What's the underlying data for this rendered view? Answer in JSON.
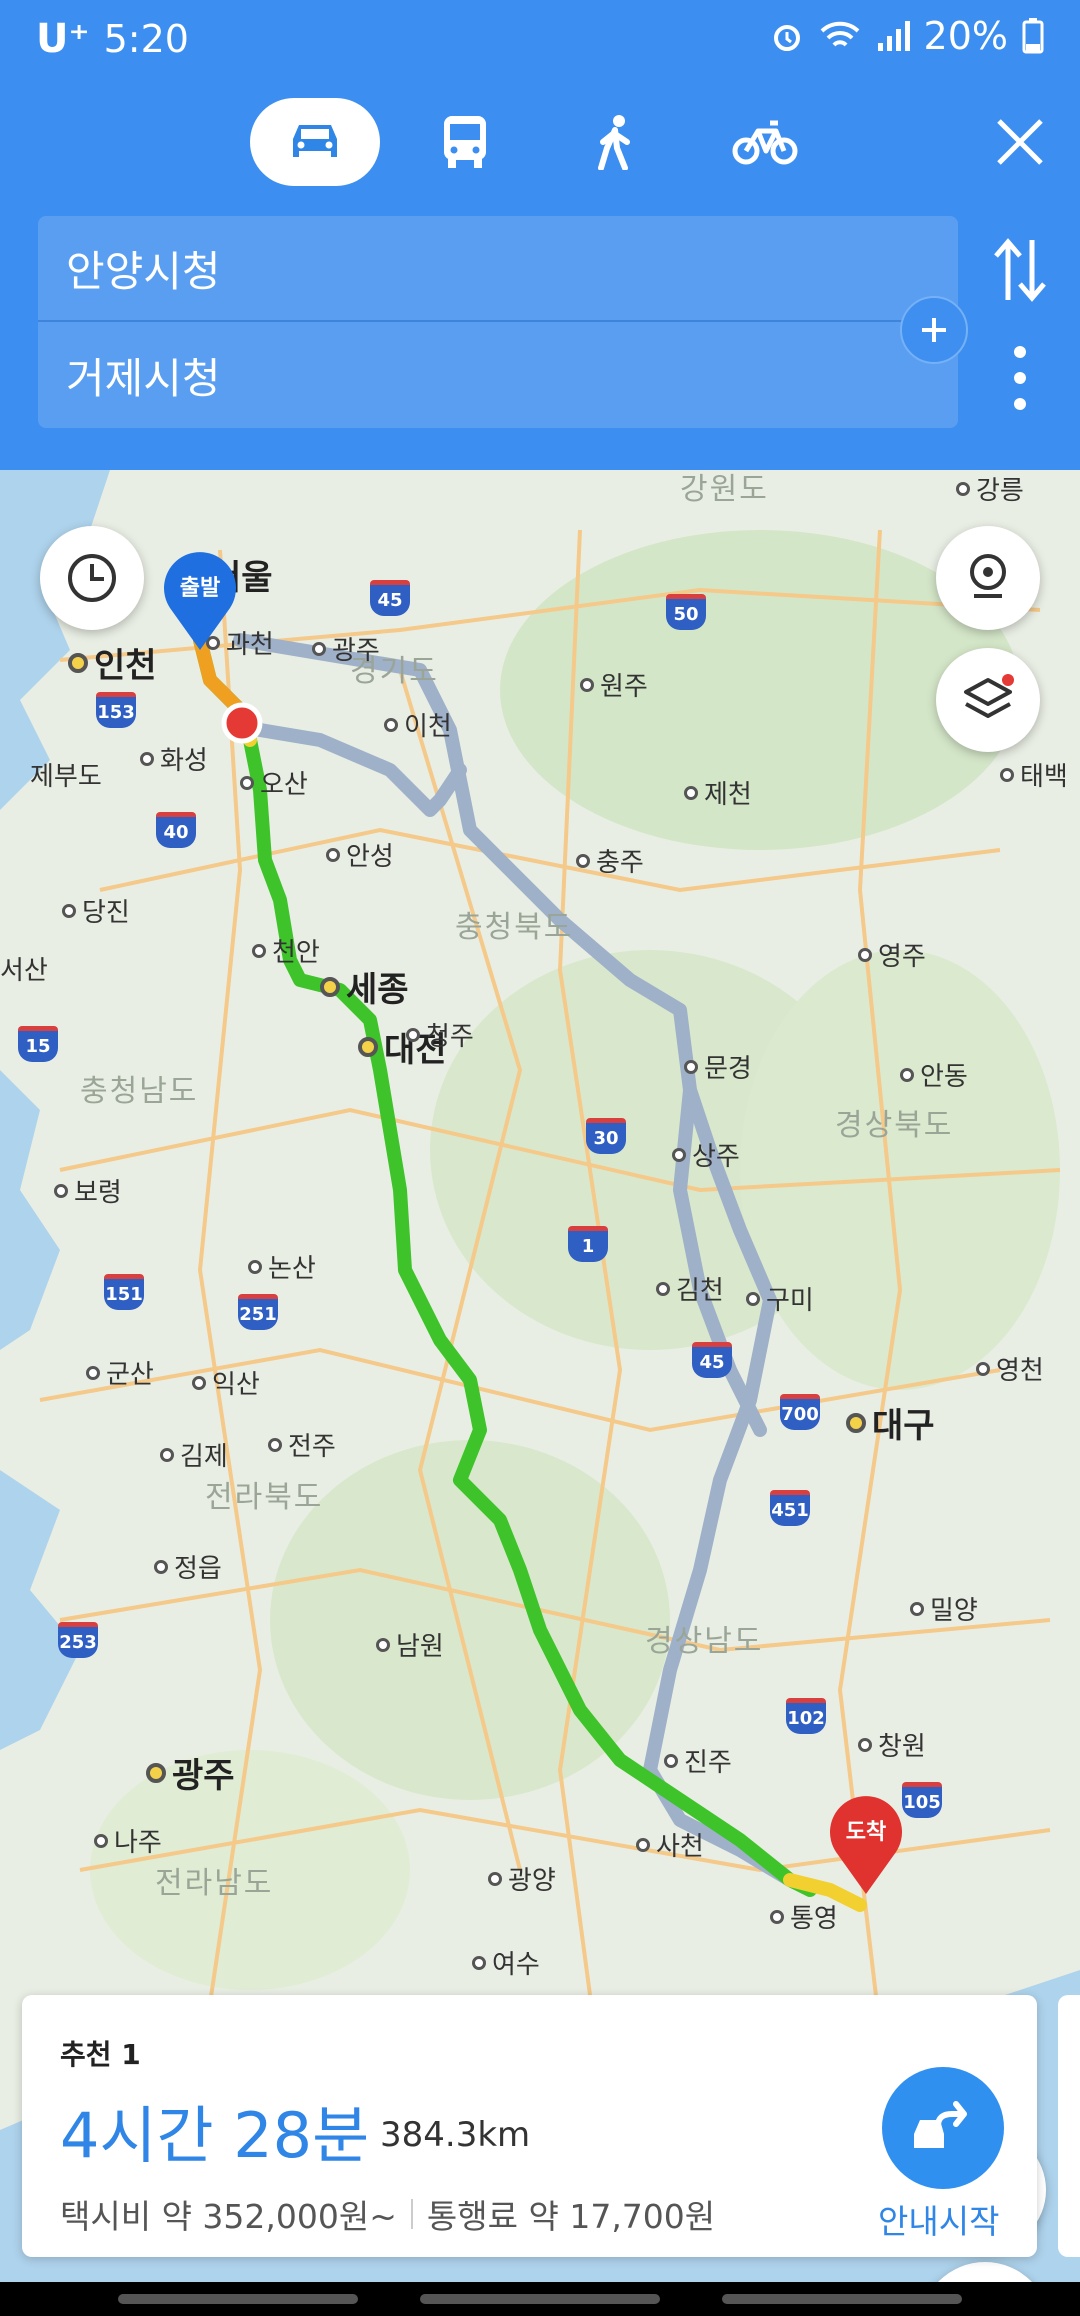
{
  "status_bar": {
    "carrier": "U⁺",
    "time": "5:20",
    "battery": "20%",
    "icons": [
      "alarm-icon",
      "wifi-icon",
      "signal-icon",
      "battery-icon"
    ]
  },
  "modes": [
    {
      "name": "car-icon",
      "active": true
    },
    {
      "name": "bus-icon",
      "active": false
    },
    {
      "name": "walk-icon",
      "active": false
    },
    {
      "name": "bike-icon",
      "active": false
    }
  ],
  "route": {
    "origin": "안양시청",
    "destination": "거제시청"
  },
  "map": {
    "regions": [
      "강원도",
      "경기도",
      "충청북도",
      "충청남도",
      "경상북도",
      "전라북도",
      "경상남도",
      "전라남도"
    ],
    "cities_major": [
      "서울",
      "인천",
      "세종",
      "대전",
      "대구",
      "광주"
    ],
    "cities": [
      "과천",
      "광주",
      "원주",
      "이천",
      "화성",
      "오산",
      "제천",
      "안성",
      "충주",
      "당진",
      "천안",
      "청주",
      "서산",
      "문경",
      "상주",
      "보령",
      "논산",
      "김천",
      "구미",
      "군산",
      "익산",
      "김제",
      "전주",
      "정읍",
      "남원",
      "진주",
      "창원",
      "사천",
      "나주",
      "광양",
      "통영",
      "여수",
      "강릉",
      "태백",
      "영주",
      "안동",
      "영천",
      "밀양",
      "제부도"
    ],
    "highways": [
      "45",
      "50",
      "153",
      "40",
      "15",
      "30",
      "1",
      "151",
      "251",
      "45",
      "700",
      "451",
      "253",
      "102",
      "105"
    ],
    "start_pin": "출발",
    "end_pin": "도착",
    "route_color": "#3ec42a",
    "alt_route_color": "#9fb1c9"
  },
  "card": {
    "label": "추천 1",
    "duration": "4시간 28분",
    "distance": "384.3km",
    "taxi_fare": "택시비 약 352,000원~",
    "toll": "통행료 약 17,700원",
    "start_label": "안내시작"
  },
  "colors": {
    "header": "#3c8ff0",
    "accent": "#2f86e6"
  }
}
